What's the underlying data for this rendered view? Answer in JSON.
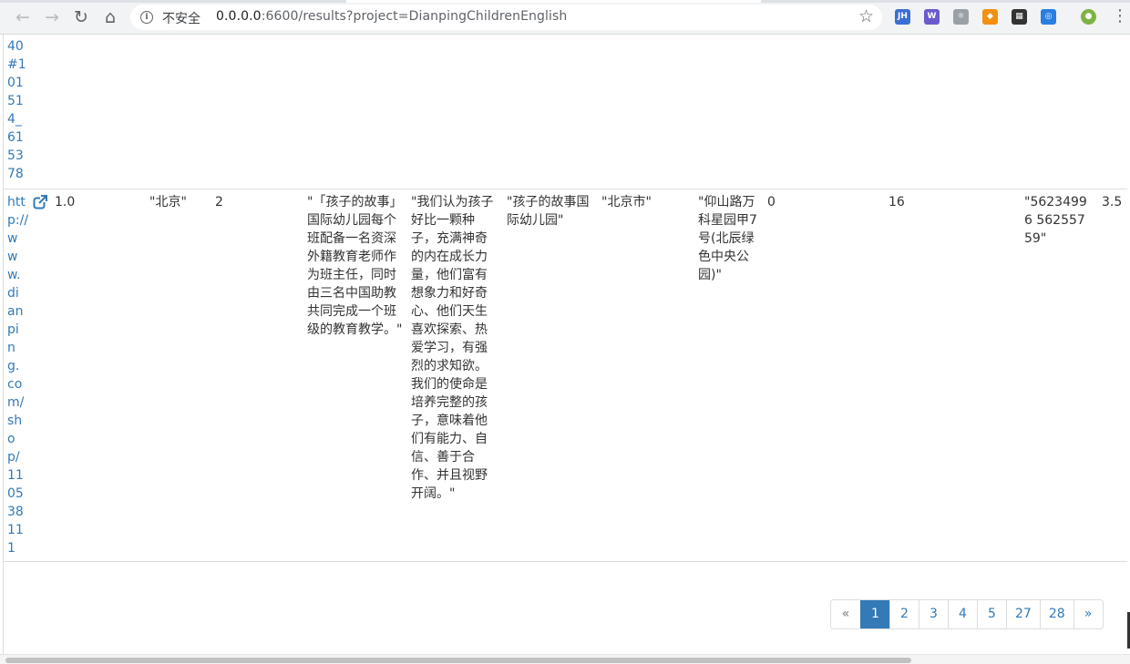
{
  "browser": {
    "security_label": "不安全",
    "url_host": "0.0.0.0",
    "url_rest": ":6600/results?project=DianpingChildrenEnglish",
    "extensions": [
      {
        "label": "JH",
        "color": "#3b6fd6"
      },
      {
        "label": "W",
        "color": "#6a5acd"
      },
      {
        "label": "⚛",
        "color": "#9aa0a6"
      },
      {
        "label": "◆",
        "color": "#f29111"
      },
      {
        "label": "▦",
        "color": "#333333"
      },
      {
        "label": "◎",
        "color": "#2a7de1"
      },
      {
        "label": "●",
        "color": "#7cb342"
      }
    ]
  },
  "table": {
    "prev_row_link_fragments": [
      "40",
      "#1",
      "01",
      "51",
      "4_",
      "61",
      "53",
      "78"
    ],
    "row": {
      "link_fragments": [
        "htt",
        "p://",
        "w",
        "w",
        "w.",
        "di",
        "an",
        "pi",
        "n",
        "g.",
        "co",
        "m/",
        "sh",
        "o",
        "p/",
        "11",
        "05",
        "38",
        "11",
        "1"
      ],
      "col_score": "1.0",
      "col_city": "\"北京\"",
      "col_count": "2",
      "col_intro": "\"「孩子的故事」国际幼儿园每个班配备一名资深外籍教育老师作为班主任，同时由三名中国助教共同完成一个班级的教育教学。\"",
      "col_mission": "\"我们认为孩子好比一颗种子，充满神奇的内在成长力量，他们富有想象力和好奇心、他们天生喜欢探索、热爱学习，有强烈的求知欲。我们的使命是培养完整的孩子，意味着他们有能力、自信、善于合作、并且视野开阔。\"",
      "col_name": "\"孩子的故事国际幼儿园\"",
      "col_city2": "\"北京市\"",
      "col_address": "\"仰山路万科星园甲7号(北辰绿色中央公园)\"",
      "col_zero": "0",
      "col_sixteen": "16",
      "col_phone": "\"56234996 56255759\"",
      "col_rating": "3.5"
    }
  },
  "pagination": {
    "prev": "«",
    "pages": [
      "1",
      "2",
      "3",
      "4",
      "5",
      "27",
      "28"
    ],
    "active_page": "1",
    "next": "»"
  }
}
